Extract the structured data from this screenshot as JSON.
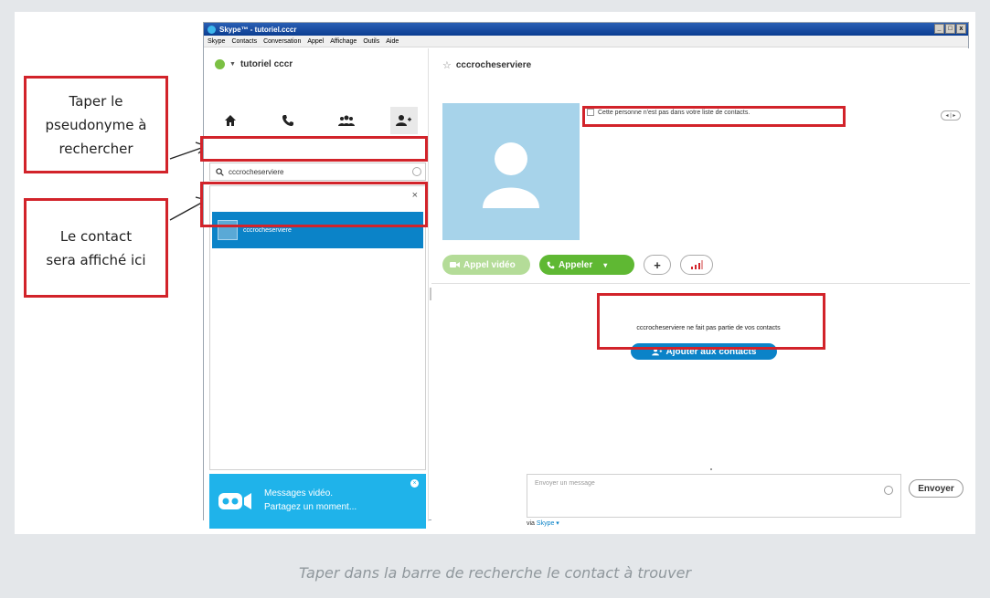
{
  "window": {
    "title": "Skype™ - tutoriel.cccr",
    "controls": [
      "_",
      "□",
      "x"
    ]
  },
  "menu": [
    "Skype",
    "Contacts",
    "Conversation",
    "Appel",
    "Affichage",
    "Outils",
    "Aide"
  ],
  "left_panel": {
    "username": "tutoriel cccr",
    "nav_icons": [
      "home-icon",
      "phone-icon",
      "contacts-icon",
      "add-contact-icon"
    ],
    "search": {
      "value": "cccrocheserviere",
      "placeholder": ""
    },
    "result_close": "×",
    "result_name": "cccrocheserviere",
    "promo": {
      "line1": "Messages vidéo.",
      "line2": "Partagez un moment..."
    }
  },
  "right_panel": {
    "contact_name": "cccrocheserviere",
    "notice": "Cette personne n'est pas dans votre liste de contacts.",
    "video_call_label": "Appel vidéo",
    "call_label": "Appeler",
    "call_caret": "▾",
    "plus_label": "+",
    "not_contact_text": "cccrocheserviere ne fait pas partie de vos contacts",
    "add_contacts_label": "Ajouter aux contacts",
    "message_placeholder": "Envoyer un message",
    "send_label": "Envoyer",
    "via_prefix": "via",
    "via_link": "Skype ▾"
  },
  "callouts": {
    "search_hint": "Taper le pseudonyme à rechercher",
    "result_hint": "Le contact sera affiché ici"
  },
  "caption": "Taper dans la barre de recherche le contact à trouver",
  "colors": {
    "highlight": "#d2232a",
    "skype_blue": "#0b83c8",
    "call_green": "#5fb833"
  }
}
